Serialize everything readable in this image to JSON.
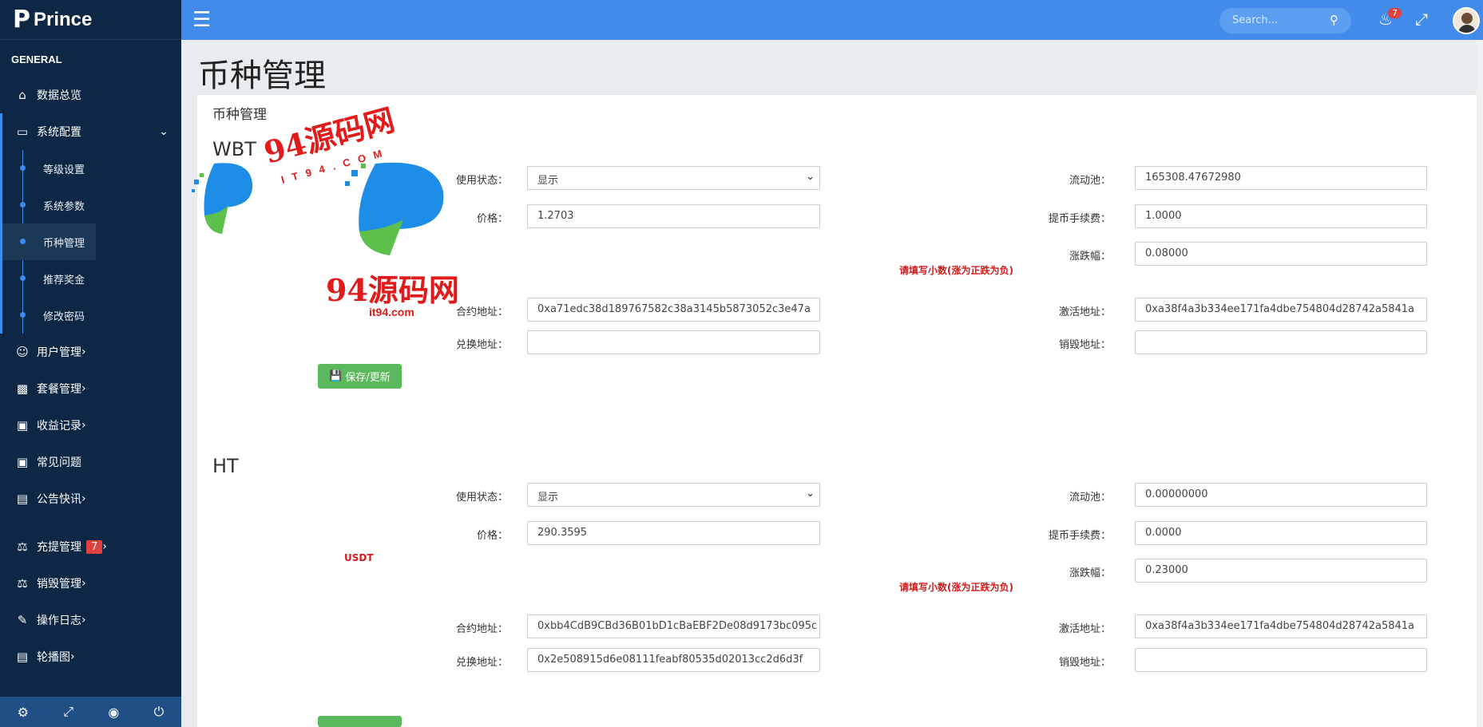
{
  "app": {
    "logo_mark": "P",
    "name": "Prince"
  },
  "sidebar": {
    "section": "GENERAL",
    "items": [
      {
        "label": "数据总览",
        "icon": "home-icon"
      },
      {
        "label": "系统配置",
        "icon": "monitor-icon"
      },
      {
        "label": "用户管理",
        "icon": "user-circle-icon"
      },
      {
        "label": "套餐管理",
        "icon": "cube-icon"
      },
      {
        "label": "收益记录",
        "icon": "money-icon"
      },
      {
        "label": "常见问题",
        "icon": "money-icon"
      },
      {
        "label": "公告快讯",
        "icon": "window-icon"
      },
      {
        "label": "充提管理",
        "icon": "balance-scale-icon",
        "badge": "7"
      },
      {
        "label": "销毁管理",
        "icon": "balance-scale-icon"
      },
      {
        "label": "操作日志",
        "icon": "edit-icon"
      },
      {
        "label": "轮播图",
        "icon": "image-icon"
      }
    ],
    "sub_items": [
      "等级设置",
      "系统参数",
      "币种管理",
      "推荐奖金",
      "修改密码"
    ]
  },
  "topbar": {
    "search_placeholder": "Search...",
    "notifications": "7"
  },
  "page": {
    "title": "币种管理",
    "panel_title": "币种管理"
  },
  "labels": {
    "status": "使用状态：",
    "pool": "流动池：",
    "price": "价格：",
    "fee": "提币手续费：",
    "change": "涨跌幅：",
    "contract": "合约地址：",
    "activate": "激活地址：",
    "exchange": "兑换地址：",
    "burn": "销毁地址：",
    "hint": "请填写小数(涨为正跌为负)",
    "save": "保存/更新"
  },
  "coins": [
    {
      "name": "WBT",
      "status": "显示",
      "pool": "165308.47672980",
      "price": "1.2703",
      "fee": "1.0000",
      "change": "0.08000",
      "contract": "0xa71edc38d189767582c38a3145b5873052c3e47a",
      "activate": "0xa38f4a3b334ee171fa4dbe754804d28742a5841a",
      "exchange": "",
      "burn": ""
    },
    {
      "name": "HT",
      "tag": "USDT",
      "status": "显示",
      "pool": "0.00000000",
      "price": "290.3595",
      "fee": "0.0000",
      "change": "0.23000",
      "contract": "0xbb4CdB9CBd36B01bD1cBaEBF2De08d9173bc095c",
      "activate": "0xa38f4a3b334ee171fa4dbe754804d28742a5841a",
      "exchange": "0x2e508915d6e08111feabf80535d02013cc2d6d3f",
      "burn": ""
    }
  ],
  "watermark": {
    "cn": "94源码网",
    "domain_upper": "IT94.COM",
    "domain_lower": "it94.com"
  },
  "colors": {
    "sidebar": "#0d2744",
    "topbar": "#428bea",
    "save": "#5cb85c",
    "hint": "#d01c1c"
  }
}
